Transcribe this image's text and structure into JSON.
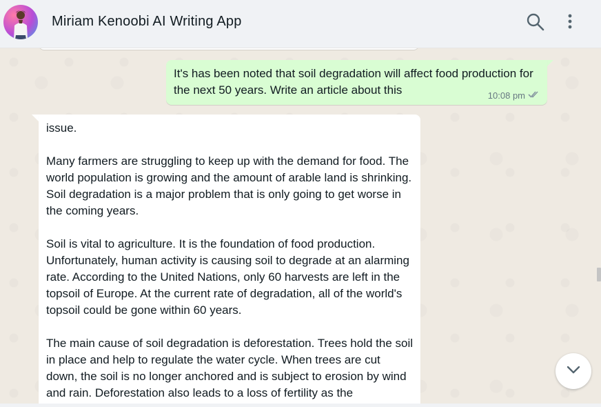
{
  "header": {
    "title": "Miriam Kenoobi AI Writing App",
    "avatar_icon": "user-avatar",
    "search_icon": "search-icon",
    "menu_icon": "kebab-menu-icon"
  },
  "messages": {
    "outgoing": {
      "text": "It's has been noted that soil degradation will affect food production for the next 50 years. Write an article about this",
      "time": "10:08 pm",
      "status_icon": "double-check-icon"
    },
    "incoming": {
      "paragraphs": [
        "issue.",
        "Many farmers are struggling to keep up with the demand for food. The world population is growing and the amount of arable land is shrinking. Soil degradation is a major problem that is only going to get worse in the coming years.",
        "Soil is vital to agriculture. It is the foundation of food production. Unfortunately, human activity is causing soil to degrade at an alarming rate. According to the United Nations, only 60 harvests are left in the topsoil of Europe. At the current rate of degradation, all of the world's topsoil could be gone within 60 years.",
        "The main cause of soil degradation is deforestation. Trees hold the soil in place and help to regulate the water cycle. When trees are cut down, the soil is no longer anchored and is subject to erosion by wind and rain. Deforestation also leads to a loss of fertility as the"
      ]
    }
  },
  "controls": {
    "scroll_down_icon": "chevron-down-icon"
  },
  "colors": {
    "header_bg": "#f0f2f5",
    "chat_bg": "#efeae2",
    "outgoing_bubble": "#d9fdd3",
    "incoming_bubble": "#ffffff",
    "icon_gray": "#54656f"
  }
}
